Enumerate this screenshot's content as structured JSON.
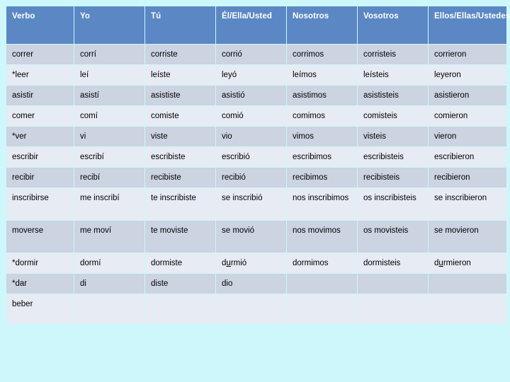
{
  "slide": {
    "background_color": "#cdf7fb",
    "header_color": "#5b87c5",
    "header_text_color": "#ffffff",
    "row_color_odd": "#ccd3e1",
    "row_color_even": "#e7ebf3"
  },
  "table": {
    "headers": [
      "Verbo",
      "Yo",
      "Tú",
      "Él/Ella/Usted",
      "Nosotros",
      "Vosotros",
      "Ellos/Ellas/Ustedes"
    ],
    "rows": [
      {
        "cells": [
          "correr",
          "corrí",
          "corriste",
          "corrió",
          "corrimos",
          "corristeis",
          "corrieron"
        ]
      },
      {
        "cells": [
          "*leer",
          "leí",
          "leíste",
          "leyó",
          "leímos",
          "leísteis",
          "leyeron"
        ]
      },
      {
        "cells": [
          "asistir",
          "asistí",
          "asististe",
          "asistió",
          "asistimos",
          "asististeis",
          "asistieron"
        ]
      },
      {
        "cells": [
          "comer",
          "comí",
          "comiste",
          "comió",
          "comimos",
          "comisteis",
          "comieron"
        ]
      },
      {
        "cells": [
          "*ver",
          "vi",
          "viste",
          "vio",
          "vimos",
          "visteis",
          "vieron"
        ]
      },
      {
        "cells": [
          "escribir",
          "escribí",
          "escribiste",
          "escribió",
          "escribimos",
          "escribisteis",
          "escribieron"
        ]
      },
      {
        "cells": [
          "recibir",
          "recibí",
          "recibiste",
          "recibió",
          "recibimos",
          "recibisteis",
          "recibieron"
        ]
      },
      {
        "cells": [
          "inscribirse",
          "me inscribí",
          "te inscribiste",
          "se inscribió",
          "nos inscribimos",
          "os inscribisteis",
          "se inscribieron"
        ]
      },
      {
        "cells": [
          "moverse",
          "me moví",
          "te moviste",
          "se movió",
          "nos movimos",
          "os movisteis",
          "se movieron"
        ]
      },
      {
        "cells": [
          "*dormir",
          "dormí",
          "dormiste",
          "durmió",
          "dormimos",
          "dormisteis",
          "durmieron"
        ],
        "underline_stem": [
          false,
          false,
          false,
          true,
          false,
          false,
          true
        ]
      },
      {
        "cells": [
          "*dar",
          "di",
          "diste",
          "dio",
          "",
          "",
          ""
        ]
      },
      {
        "cells": [
          "beber",
          "",
          "",
          "",
          "",
          "",
          ""
        ]
      }
    ]
  }
}
